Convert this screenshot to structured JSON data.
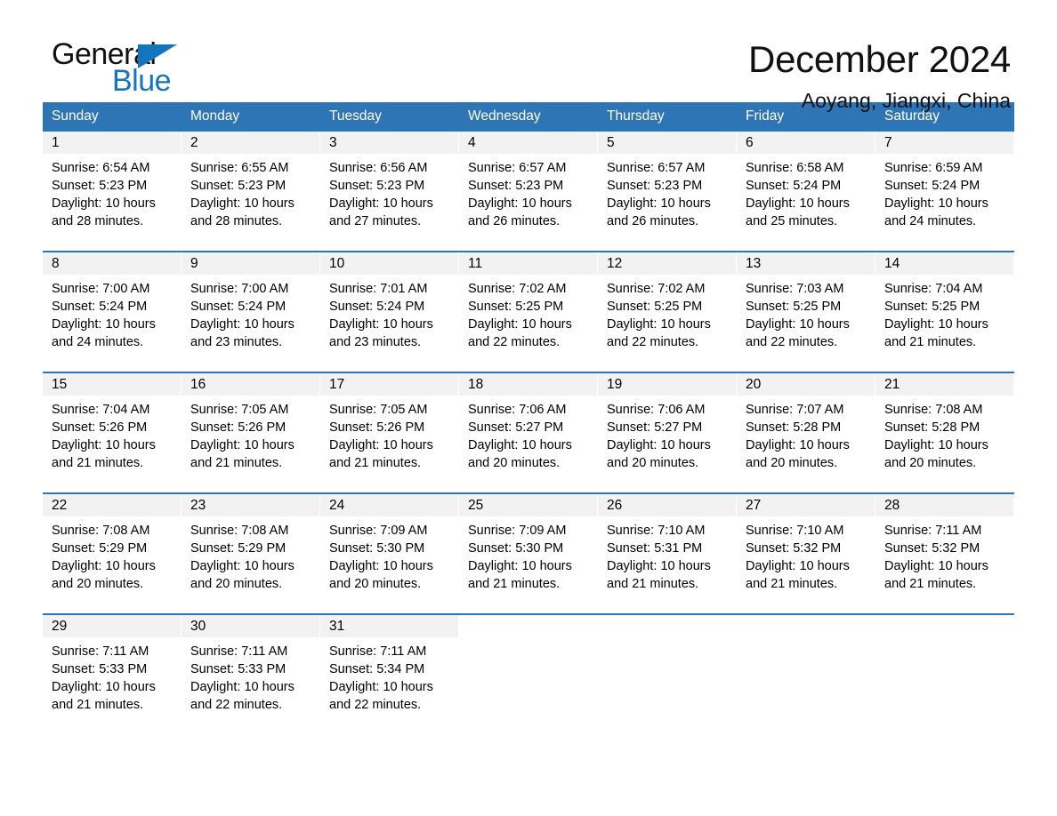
{
  "brand": {
    "name_top": "General",
    "name_bottom": "Blue",
    "accent_color": "#1474bd"
  },
  "header": {
    "title": "December 2024",
    "subtitle": "Aoyang, Jiangxi, China"
  },
  "theme": {
    "header_blue": "#2e75b6",
    "daynum_bg": "#f2f2f2",
    "text": "#000000"
  },
  "calendar": {
    "weekdays": [
      "Sunday",
      "Monday",
      "Tuesday",
      "Wednesday",
      "Thursday",
      "Friday",
      "Saturday"
    ],
    "weeks": [
      [
        {
          "day": "1",
          "sunrise": "Sunrise: 6:54 AM",
          "sunset": "Sunset: 5:23 PM",
          "daylight_1": "Daylight: 10 hours",
          "daylight_2": "and 28 minutes."
        },
        {
          "day": "2",
          "sunrise": "Sunrise: 6:55 AM",
          "sunset": "Sunset: 5:23 PM",
          "daylight_1": "Daylight: 10 hours",
          "daylight_2": "and 28 minutes."
        },
        {
          "day": "3",
          "sunrise": "Sunrise: 6:56 AM",
          "sunset": "Sunset: 5:23 PM",
          "daylight_1": "Daylight: 10 hours",
          "daylight_2": "and 27 minutes."
        },
        {
          "day": "4",
          "sunrise": "Sunrise: 6:57 AM",
          "sunset": "Sunset: 5:23 PM",
          "daylight_1": "Daylight: 10 hours",
          "daylight_2": "and 26 minutes."
        },
        {
          "day": "5",
          "sunrise": "Sunrise: 6:57 AM",
          "sunset": "Sunset: 5:23 PM",
          "daylight_1": "Daylight: 10 hours",
          "daylight_2": "and 26 minutes."
        },
        {
          "day": "6",
          "sunrise": "Sunrise: 6:58 AM",
          "sunset": "Sunset: 5:24 PM",
          "daylight_1": "Daylight: 10 hours",
          "daylight_2": "and 25 minutes."
        },
        {
          "day": "7",
          "sunrise": "Sunrise: 6:59 AM",
          "sunset": "Sunset: 5:24 PM",
          "daylight_1": "Daylight: 10 hours",
          "daylight_2": "and 24 minutes."
        }
      ],
      [
        {
          "day": "8",
          "sunrise": "Sunrise: 7:00 AM",
          "sunset": "Sunset: 5:24 PM",
          "daylight_1": "Daylight: 10 hours",
          "daylight_2": "and 24 minutes."
        },
        {
          "day": "9",
          "sunrise": "Sunrise: 7:00 AM",
          "sunset": "Sunset: 5:24 PM",
          "daylight_1": "Daylight: 10 hours",
          "daylight_2": "and 23 minutes."
        },
        {
          "day": "10",
          "sunrise": "Sunrise: 7:01 AM",
          "sunset": "Sunset: 5:24 PM",
          "daylight_1": "Daylight: 10 hours",
          "daylight_2": "and 23 minutes."
        },
        {
          "day": "11",
          "sunrise": "Sunrise: 7:02 AM",
          "sunset": "Sunset: 5:25 PM",
          "daylight_1": "Daylight: 10 hours",
          "daylight_2": "and 22 minutes."
        },
        {
          "day": "12",
          "sunrise": "Sunrise: 7:02 AM",
          "sunset": "Sunset: 5:25 PM",
          "daylight_1": "Daylight: 10 hours",
          "daylight_2": "and 22 minutes."
        },
        {
          "day": "13",
          "sunrise": "Sunrise: 7:03 AM",
          "sunset": "Sunset: 5:25 PM",
          "daylight_1": "Daylight: 10 hours",
          "daylight_2": "and 22 minutes."
        },
        {
          "day": "14",
          "sunrise": "Sunrise: 7:04 AM",
          "sunset": "Sunset: 5:25 PM",
          "daylight_1": "Daylight: 10 hours",
          "daylight_2": "and 21 minutes."
        }
      ],
      [
        {
          "day": "15",
          "sunrise": "Sunrise: 7:04 AM",
          "sunset": "Sunset: 5:26 PM",
          "daylight_1": "Daylight: 10 hours",
          "daylight_2": "and 21 minutes."
        },
        {
          "day": "16",
          "sunrise": "Sunrise: 7:05 AM",
          "sunset": "Sunset: 5:26 PM",
          "daylight_1": "Daylight: 10 hours",
          "daylight_2": "and 21 minutes."
        },
        {
          "day": "17",
          "sunrise": "Sunrise: 7:05 AM",
          "sunset": "Sunset: 5:26 PM",
          "daylight_1": "Daylight: 10 hours",
          "daylight_2": "and 21 minutes."
        },
        {
          "day": "18",
          "sunrise": "Sunrise: 7:06 AM",
          "sunset": "Sunset: 5:27 PM",
          "daylight_1": "Daylight: 10 hours",
          "daylight_2": "and 20 minutes."
        },
        {
          "day": "19",
          "sunrise": "Sunrise: 7:06 AM",
          "sunset": "Sunset: 5:27 PM",
          "daylight_1": "Daylight: 10 hours",
          "daylight_2": "and 20 minutes."
        },
        {
          "day": "20",
          "sunrise": "Sunrise: 7:07 AM",
          "sunset": "Sunset: 5:28 PM",
          "daylight_1": "Daylight: 10 hours",
          "daylight_2": "and 20 minutes."
        },
        {
          "day": "21",
          "sunrise": "Sunrise: 7:08 AM",
          "sunset": "Sunset: 5:28 PM",
          "daylight_1": "Daylight: 10 hours",
          "daylight_2": "and 20 minutes."
        }
      ],
      [
        {
          "day": "22",
          "sunrise": "Sunrise: 7:08 AM",
          "sunset": "Sunset: 5:29 PM",
          "daylight_1": "Daylight: 10 hours",
          "daylight_2": "and 20 minutes."
        },
        {
          "day": "23",
          "sunrise": "Sunrise: 7:08 AM",
          "sunset": "Sunset: 5:29 PM",
          "daylight_1": "Daylight: 10 hours",
          "daylight_2": "and 20 minutes."
        },
        {
          "day": "24",
          "sunrise": "Sunrise: 7:09 AM",
          "sunset": "Sunset: 5:30 PM",
          "daylight_1": "Daylight: 10 hours",
          "daylight_2": "and 20 minutes."
        },
        {
          "day": "25",
          "sunrise": "Sunrise: 7:09 AM",
          "sunset": "Sunset: 5:30 PM",
          "daylight_1": "Daylight: 10 hours",
          "daylight_2": "and 21 minutes."
        },
        {
          "day": "26",
          "sunrise": "Sunrise: 7:10 AM",
          "sunset": "Sunset: 5:31 PM",
          "daylight_1": "Daylight: 10 hours",
          "daylight_2": "and 21 minutes."
        },
        {
          "day": "27",
          "sunrise": "Sunrise: 7:10 AM",
          "sunset": "Sunset: 5:32 PM",
          "daylight_1": "Daylight: 10 hours",
          "daylight_2": "and 21 minutes."
        },
        {
          "day": "28",
          "sunrise": "Sunrise: 7:11 AM",
          "sunset": "Sunset: 5:32 PM",
          "daylight_1": "Daylight: 10 hours",
          "daylight_2": "and 21 minutes."
        }
      ],
      [
        {
          "day": "29",
          "sunrise": "Sunrise: 7:11 AM",
          "sunset": "Sunset: 5:33 PM",
          "daylight_1": "Daylight: 10 hours",
          "daylight_2": "and 21 minutes."
        },
        {
          "day": "30",
          "sunrise": "Sunrise: 7:11 AM",
          "sunset": "Sunset: 5:33 PM",
          "daylight_1": "Daylight: 10 hours",
          "daylight_2": "and 22 minutes."
        },
        {
          "day": "31",
          "sunrise": "Sunrise: 7:11 AM",
          "sunset": "Sunset: 5:34 PM",
          "daylight_1": "Daylight: 10 hours",
          "daylight_2": "and 22 minutes."
        },
        {
          "day": "",
          "sunrise": "",
          "sunset": "",
          "daylight_1": "",
          "daylight_2": ""
        },
        {
          "day": "",
          "sunrise": "",
          "sunset": "",
          "daylight_1": "",
          "daylight_2": ""
        },
        {
          "day": "",
          "sunrise": "",
          "sunset": "",
          "daylight_1": "",
          "daylight_2": ""
        },
        {
          "day": "",
          "sunrise": "",
          "sunset": "",
          "daylight_1": "",
          "daylight_2": ""
        }
      ]
    ]
  }
}
